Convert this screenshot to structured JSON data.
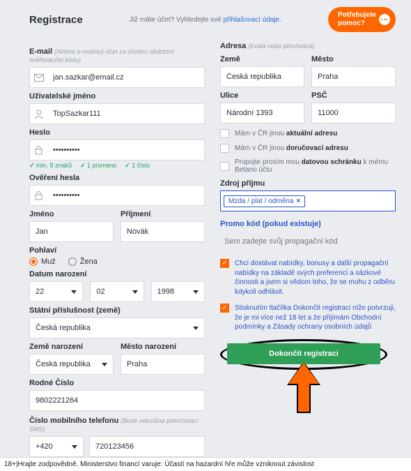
{
  "topbar": {
    "title": "Registrace",
    "already_text": "Již máte účet? Vyhledejte své ",
    "login_link": "přihlašovací údaje",
    "period": ".",
    "help_line1": "Potřebujete",
    "help_line2": "pomoc?"
  },
  "left": {
    "email_label": "E-mail",
    "email_hint": "(Aktivní e-mailový účet za účelem obdržení ověřovacího kódu)",
    "email_value": "jan.sazkar@email.cz",
    "username_label": "Uživatelské jméno",
    "username_value": "TopSazkar111",
    "password_label": "Heslo",
    "password_value": "••••••••••",
    "rule1": "min. 8 znaků",
    "rule2": "1 písmeno",
    "rule3": "1 číslo",
    "password2_label": "Ověření hesla",
    "password2_value": "••••••••••",
    "firstname_label": "Jméno",
    "firstname_value": "Jan",
    "lastname_label": "Příjmení",
    "lastname_value": "Novák",
    "gender_label": "Pohlaví",
    "gender_male": "Muž",
    "gender_female": "Žena",
    "dob_label": "Datum narození",
    "dob_day": "22",
    "dob_month": "02",
    "dob_year": "1998",
    "nationality_label": "Státní příslušnost (země)",
    "nationality_value": "Česká republika",
    "birth_country_label": "Země narození",
    "birth_country_value": "Česká republika",
    "birth_city_label": "Město narození",
    "birth_city_value": "Praha",
    "pid_label": "Rodné Číslo",
    "pid_value": "9802221264",
    "phone_label": "Číslo mobilního telefonu",
    "phone_hint": "(Bude odeslána potvrzovací SMS)",
    "phone_code": "+420",
    "phone_value": "720123456"
  },
  "right": {
    "address_hdr": "Adresa",
    "address_hint": "(trvalá nebo přechodná)",
    "country_label": "Země",
    "country_value": "Česká republika",
    "city_label": "Město",
    "city_value": "Praha",
    "street_label": "Ulice",
    "street_value": "Národní 1393",
    "zip_label": "PSČ",
    "zip_value": "11000",
    "alt_current_pre": "Mám v ČR jinou ",
    "alt_current_b": "aktuální adresu",
    "alt_delivery_pre": "Mám v ČR jinou ",
    "alt_delivery_b": "doručovací adresu",
    "databox_pre": "Propojte prosím mou ",
    "databox_b": "datovou schránku",
    "databox_post": " k mému Betano účtu",
    "income_label": "Zdroj příjmu",
    "income_tag": "Mzda / plat / odměna",
    "promo_label": "Promo kód (pokud existuje)",
    "promo_placeholder": "Sem zadejte svůj propagační kód",
    "consent1": "Chci dostávat nabídky, bonusy a další propagační nabídky na základě svých preferencí a sázkové činnosti a jsem si vědom toho, že se mohu z odběru kdykoli odhlásit.",
    "consent2_pre": "Stisknutím tlačítka Dokončit registraci níže potvrzuji, že je mi více než 18 let a že přijímám ",
    "consent2_link1": "Obchodní podmínky",
    "consent2_mid": " a ",
    "consent2_link2": "Zásady ochrany osobních údajů",
    "submit": "Dokončit registraci"
  },
  "footer": "18+|Hrajte zodpovědně. Ministerstvo financí varuje: Účastí na hazardní hře může vzniknout závislost"
}
